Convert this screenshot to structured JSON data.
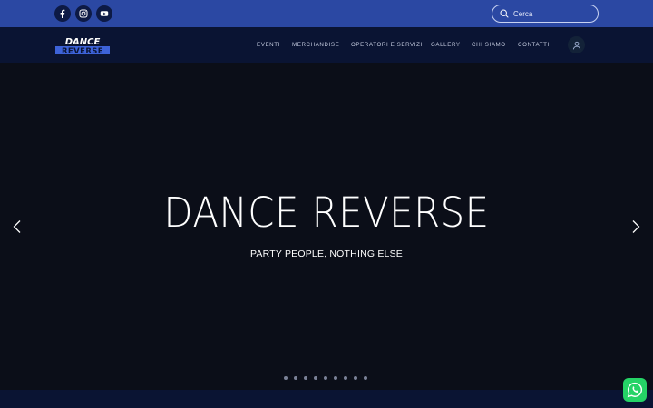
{
  "social": {
    "facebook_icon": "facebook-icon",
    "instagram_icon": "instagram-icon",
    "youtube_icon": "youtube-icon"
  },
  "search": {
    "placeholder": "Cerca",
    "icon": "search-icon"
  },
  "logo": {
    "text_top": "DANCE",
    "text_bottom": "REVERSE"
  },
  "nav": {
    "items": [
      "EVENTI",
      "MERCHANDISE",
      "OPERATORI E SERVIZI",
      "GALLERY",
      "CHI SIAMO",
      "CONTATTI"
    ],
    "account_icon": "user-icon"
  },
  "hero": {
    "title": "DANCE REVERSE",
    "subtitle": "PARTY PEOPLE, NOTHING ELSE",
    "slide_count": 9,
    "prev_icon": "chevron-left-icon",
    "next_icon": "chevron-right-icon"
  },
  "whatsapp": {
    "icon": "whatsapp-icon"
  },
  "colors": {
    "topbar": "#2b48a3",
    "navbar": "#0a1433",
    "hero": "#0b0e18",
    "whatsapp": "#25d366"
  }
}
